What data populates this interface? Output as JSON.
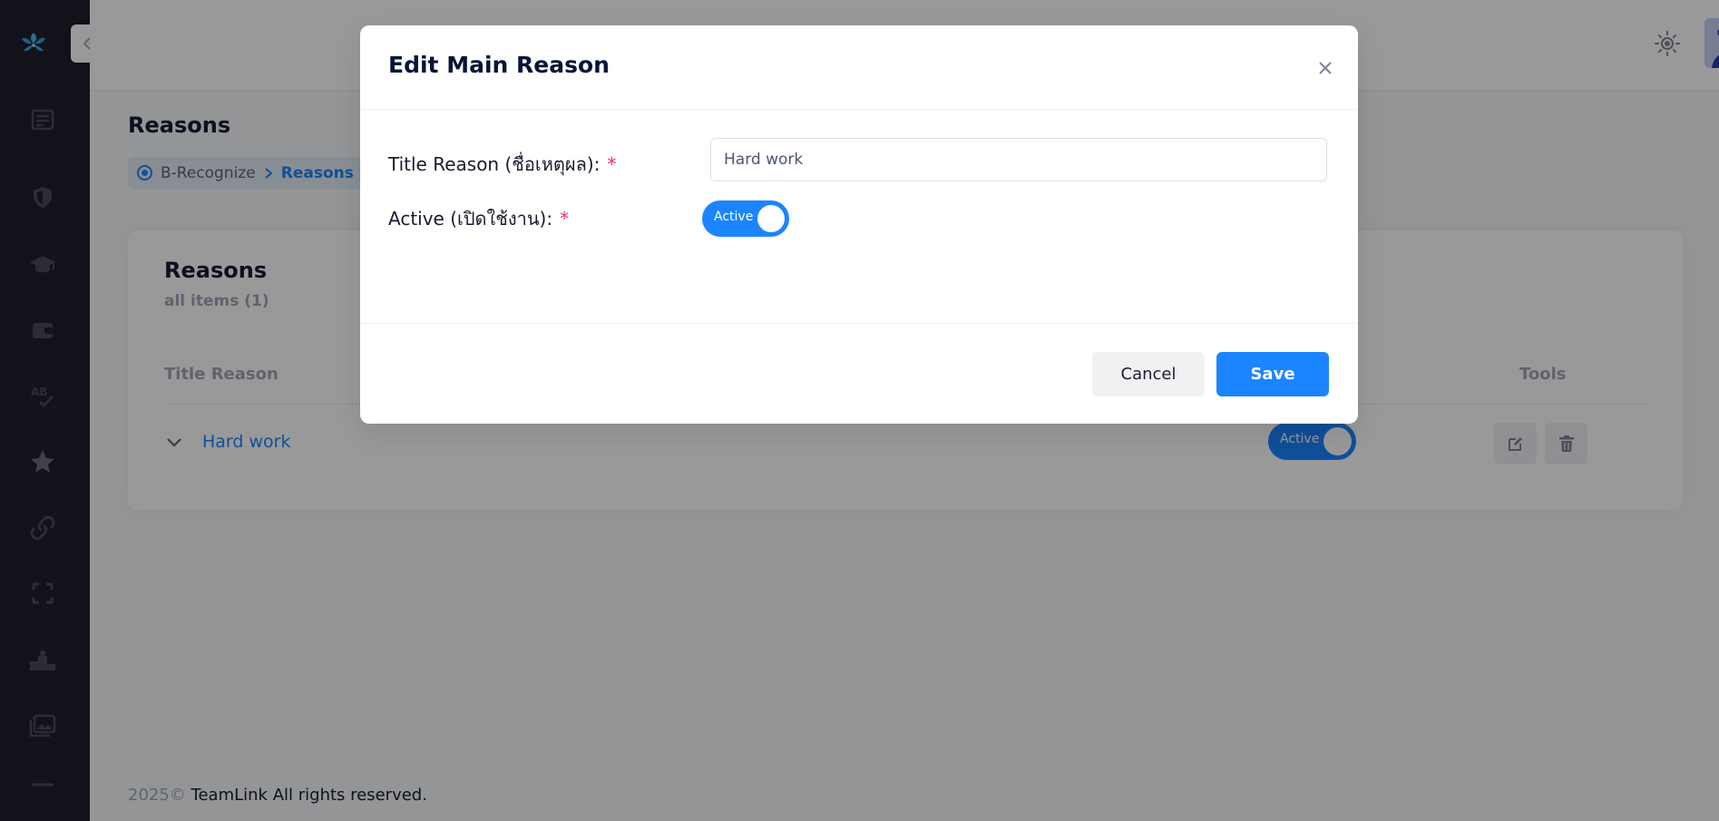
{
  "page": {
    "title": "Reasons",
    "breadcrumb": {
      "home": "B-Recognize",
      "current": "Reasons"
    }
  },
  "card": {
    "title": "Reasons",
    "subtitle": "all items (1)",
    "columns": {
      "title": "Title Reason",
      "tools": "Tools"
    },
    "rows": [
      {
        "title": "Hard work",
        "status": "Active"
      }
    ]
  },
  "footer": {
    "year": "2025©",
    "brand": "TeamLink All rights reserved."
  },
  "modal": {
    "title": "Edit Main Reason",
    "fields": {
      "title_label": "Title Reason (ชื่อเหตุผล):",
      "title_value": "Hard work",
      "active_label": "Active (เปิดใช้งาน):",
      "active_value": "Active",
      "required_mark": "*"
    },
    "cancel_label": "Cancel",
    "save_label": "Save"
  },
  "colors": {
    "primary": "#1b84ff",
    "sidebar": "#1e1e2d",
    "required": "#f8285a"
  },
  "icons": {
    "sidebar": [
      "dashboard-icon",
      "shield-icon",
      "graduation-cap-icon",
      "wallet-icon",
      "spellcheck-icon",
      "star-icon",
      "link-icon",
      "fullscreen-icon",
      "podium-icon",
      "images-icon",
      "minus-icon"
    ]
  }
}
